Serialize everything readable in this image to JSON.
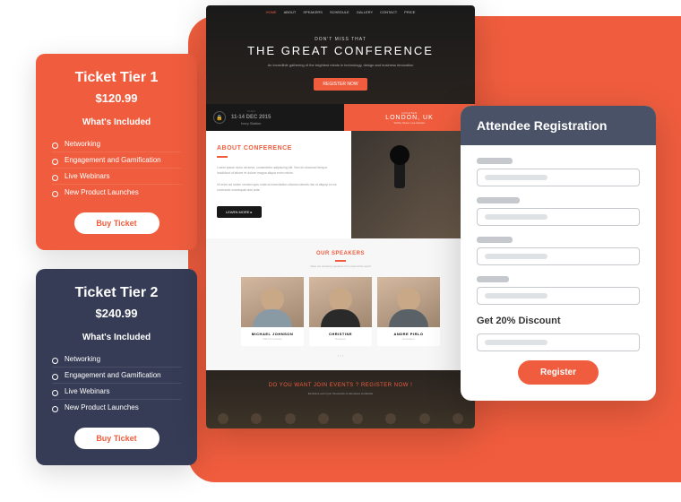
{
  "tickets": [
    {
      "title": "Ticket Tier 1",
      "price": "$120.99",
      "included_label": "What's Included",
      "items": [
        "Networking",
        "Engagement and Gamification",
        "Live Webinars",
        "New Product Launches"
      ],
      "buy": "Buy Ticket"
    },
    {
      "title": "Ticket Tier 2",
      "price": "$240.99",
      "included_label": "What's Included",
      "items": [
        "Networking",
        "Engagement and Gamification",
        "Live Webinars",
        "New Product Launches"
      ],
      "buy": "Buy Ticket"
    }
  ],
  "site": {
    "nav": [
      "HOME",
      "ABOUT",
      "SPEAKERS",
      "SCHEDULE",
      "GALLERY",
      "CONTACT",
      "PRICE"
    ],
    "hero_tag": "DON'T MISS THAT",
    "hero_title": "THE GREAT CONFERENCE",
    "hero_btn": "REGISTER NOW",
    "date": "11-14 DEC 2015",
    "venue": "Ivory Station",
    "loc_tag": "LOCATED",
    "loc": "LONDON, UK",
    "loc_sub": "Welby Street, Lee Garden",
    "about_title_a": "ABOUT ",
    "about_title_b": "CONFERENCE",
    "about_btn": "LEARN MORE ▸",
    "sp_title_a": "OUR ",
    "sp_title_b": "SPEAKERS",
    "sp_sub": "Meet our amazing speakers from around the world",
    "speakers": [
      {
        "name": "MICHAEL JOHNSON",
        "role": "CEO & Founder"
      },
      {
        "name": "CHRISTINE",
        "role": "Designer"
      },
      {
        "name": "ANDRE PIRLO",
        "role": "Developer"
      }
    ],
    "cta_a": "DO YOU WANT JOIN EVENTS ? ",
    "cta_b": "REGISTER NOW !",
    "cta_sub": "Exclusive event join thousands of attendees worldwide"
  },
  "reg": {
    "title": "Attendee Registration",
    "discount": "Get 20% Discount",
    "button": "Register"
  }
}
